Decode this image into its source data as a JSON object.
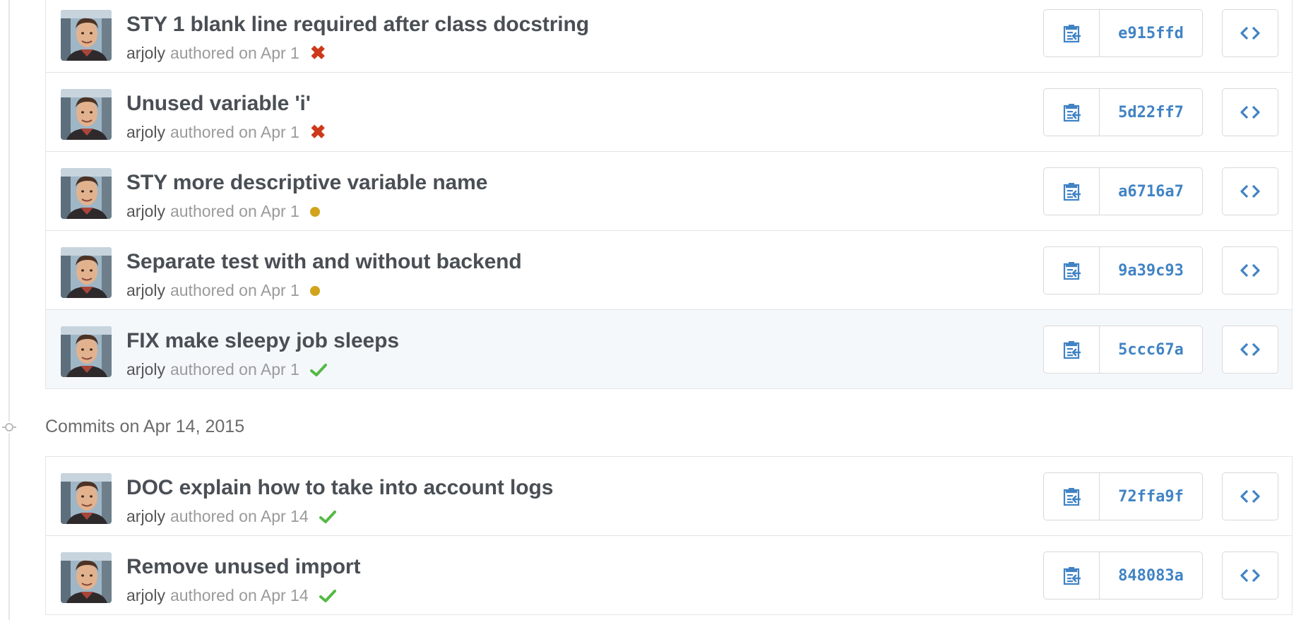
{
  "colors": {
    "accent": "#4183c4",
    "fail": "#cc3a1b",
    "pending": "#d2a41b",
    "success": "#55b946"
  },
  "groups": [
    {
      "date_label": "",
      "commits": [
        {
          "title": "STY 1 blank line required after class docstring",
          "author": "arjoly",
          "authored": "authored on Apr 1",
          "status": "failure",
          "status_icon": "x-icon",
          "sha": "e915ffd"
        },
        {
          "title": "Unused variable 'i'",
          "author": "arjoly",
          "authored": "authored on Apr 1",
          "status": "failure",
          "status_icon": "x-icon",
          "sha": "5d22ff7"
        },
        {
          "title": "STY more descriptive variable name",
          "author": "arjoly",
          "authored": "authored on Apr 1",
          "status": "pending",
          "status_icon": "dot-icon",
          "sha": "a6716a7"
        },
        {
          "title": "Separate test with and without backend",
          "author": "arjoly",
          "authored": "authored on Apr 1",
          "status": "pending",
          "status_icon": "dot-icon",
          "sha": "9a39c93"
        },
        {
          "title": "FIX make sleepy job sleeps",
          "author": "arjoly",
          "authored": "authored on Apr 1",
          "status": "success",
          "status_icon": "check-icon",
          "sha": "5ccc67a"
        }
      ]
    },
    {
      "date_label": "Commits on Apr 14, 2015",
      "commits": [
        {
          "title": "DOC explain how to take into account logs",
          "author": "arjoly",
          "authored": "authored on Apr 14",
          "status": "success",
          "status_icon": "check-icon",
          "sha": "72ffa9f"
        },
        {
          "title": "Remove unused import",
          "author": "arjoly",
          "authored": "authored on Apr 14",
          "status": "success",
          "status_icon": "check-icon",
          "sha": "848083a"
        }
      ]
    }
  ]
}
